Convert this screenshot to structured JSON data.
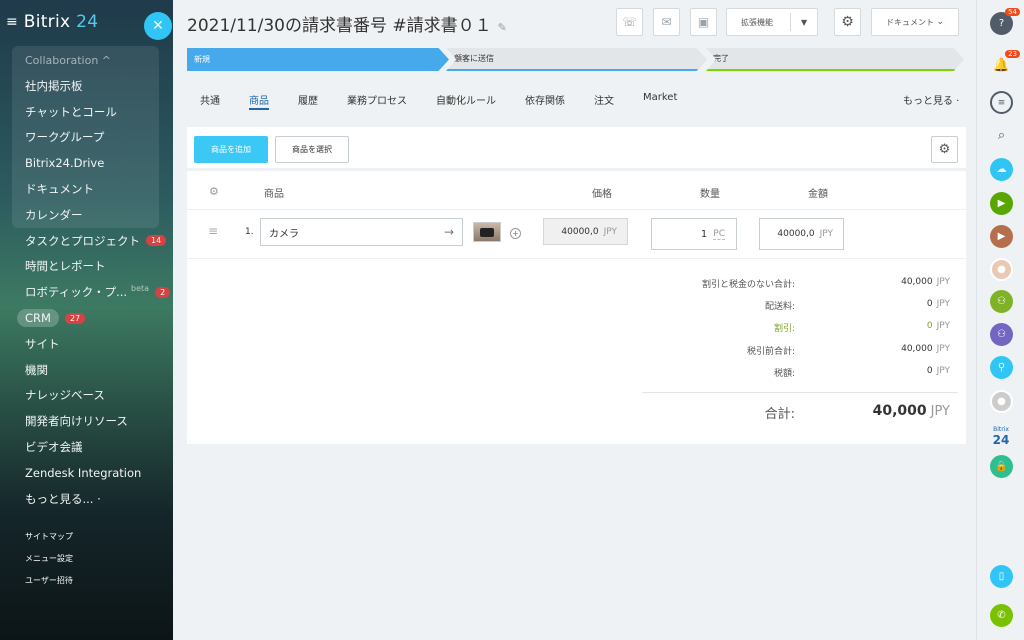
{
  "sidebar": {
    "logo_text": "Bitrix",
    "logo_number": "24",
    "collab_title": "Collaboration ^",
    "items": [
      {
        "label": "社内掲示板"
      },
      {
        "label": "チャットとコール"
      },
      {
        "label": "ワークグループ"
      },
      {
        "label": "Bitrix24.Drive"
      },
      {
        "label": "ドキュメント"
      },
      {
        "label": "カレンダー"
      },
      {
        "label": "タスクとプロジェクト",
        "badge": "14"
      },
      {
        "label": "時間とレポート"
      },
      {
        "label": "ロボティック・プ...",
        "beta": "beta",
        "badge": "2"
      },
      {
        "label": "CRM",
        "badge": "27"
      },
      {
        "label": "サイト"
      },
      {
        "label": "機関"
      },
      {
        "label": "ナレッジベース"
      },
      {
        "label": "開発者向けリソース"
      },
      {
        "label": "ビデオ会議"
      },
      {
        "label": "Zendesk Integration"
      },
      {
        "label": "もっと見る... ·"
      }
    ],
    "footer": [
      "サイトマップ",
      "メニュー設定",
      "ユーザー招待"
    ]
  },
  "header": {
    "title": "2021/11/30の請求書番号 #請求書０１",
    "extensions_label": "拡張機能",
    "documents_label": "ドキュメント"
  },
  "stages": [
    {
      "label": "新規",
      "color": "#45a9eb"
    },
    {
      "label": "顧客に送信"
    },
    {
      "label": "完了",
      "color": "#7bd500"
    }
  ],
  "tabs": [
    {
      "label": "共通"
    },
    {
      "label": "商品",
      "active": true
    },
    {
      "label": "履歴"
    },
    {
      "label": "業務プロセス"
    },
    {
      "label": "自動化ルール"
    },
    {
      "label": "依存関係"
    },
    {
      "label": "注文"
    },
    {
      "label": "Market"
    }
  ],
  "more_tabs": "もっと見る ·",
  "products": {
    "add_label": "商品を追加",
    "select_label": "商品を選択",
    "columns": {
      "product": "商品",
      "price": "価格",
      "quantity": "数量",
      "amount": "金額"
    },
    "rows": [
      {
        "num": "1.",
        "name": "カメラ",
        "price": "40000,0",
        "currency": "JPY",
        "quantity": "1",
        "unit": "PC",
        "amount": "40000,0"
      }
    ]
  },
  "totals": {
    "subtotal_label": "割引と税金のない合計:",
    "subtotal_value": "40,000",
    "delivery_label": "配送料:",
    "delivery_value": "0",
    "discount_label": "割引:",
    "discount_value": "0",
    "pretax_label": "税引前合計:",
    "pretax_value": "40,000",
    "tax_label": "税額:",
    "tax_value": "0",
    "grand_label": "合計:",
    "grand_value": "40,000",
    "currency": "JPY"
  },
  "rightbar": {
    "help_badge": "54",
    "notify_badge": "23",
    "bitrix_label": "Bitrix",
    "bitrix_num": "24"
  },
  "colors": {
    "accent": "#2fc6f6",
    "add_button": "#3bc8f5",
    "active_tab": "#2067b0"
  }
}
